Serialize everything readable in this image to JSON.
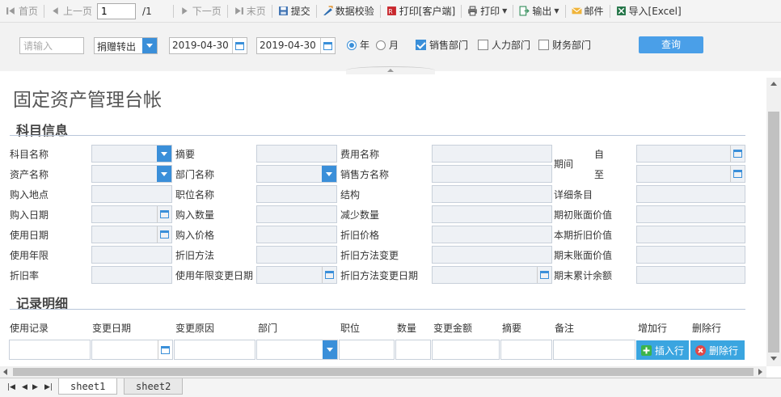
{
  "toolbar": {
    "first": "首页",
    "prev": "上一页",
    "page_value": "1",
    "page_total": "/1",
    "next": "下一页",
    "last": "末页",
    "submit": "提交",
    "validate": "数据校验",
    "print_client": "打印[客户端]",
    "print": "打印",
    "export": "输出",
    "mail": "邮件",
    "import_excel": "导入[Excel]"
  },
  "query": {
    "input_placeholder": "请输入",
    "type_value": "捐赠转出",
    "date_from": "2019-04-30",
    "date_to": "2019-04-30",
    "radio_year": "年",
    "radio_month": "月",
    "check_sales": "销售部门",
    "check_hr": "人力部门",
    "check_finance": "财务部门",
    "search_button": "查询"
  },
  "report": {
    "title": "固定资产管理台帐",
    "section_subject": "科目信息",
    "section_records": "记录明细",
    "labels": {
      "subject_name": "科目名称",
      "summary": "摘要",
      "expense_name": "费用名称",
      "period": "期间",
      "from": "自",
      "to": "至",
      "asset_name": "资产名称",
      "dept_name": "部门名称",
      "seller_name": "销售方名称",
      "purchase_place": "购入地点",
      "position_name": "职位名称",
      "structure": "结构",
      "detail_entry": "详细条目",
      "purchase_date": "购入日期",
      "purchase_qty": "购入数量",
      "decrease_qty": "减少数量",
      "opening_book_value": "期初账面价值",
      "use_date": "使用日期",
      "purchase_price": "购入价格",
      "depreciation_price": "折旧价格",
      "current_depreciation": "本期折旧价值",
      "useful_life": "使用年限",
      "depreciation_method": "折旧方法",
      "depreciation_method_change": "折旧方法变更",
      "closing_book_value": "期末账面价值",
      "depreciation_rate": "折旧率",
      "life_change_date": "使用年限变更日期",
      "method_change_date": "折旧方法变更日期",
      "accumulated_balance": "期末累计余额"
    },
    "columns": [
      "使用记录",
      "变更日期",
      "变更原因",
      "部门",
      "职位",
      "数量",
      "变更金额",
      "摘要",
      "备注",
      "增加行",
      "删除行"
    ],
    "insert_button": "插入行",
    "delete_button": "删除行"
  },
  "sheets": [
    "sheet1",
    "sheet2"
  ],
  "colors": {
    "accent": "#3a8fd9",
    "insert": "#3aa5e0",
    "delete_icon": "#e04848",
    "add_icon": "#3cb44a"
  }
}
